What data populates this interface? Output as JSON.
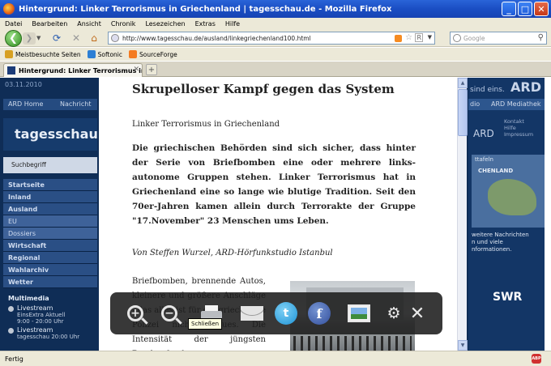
{
  "window": {
    "title": "Hintergrund: Linker Terrorismus in Griechenland | tagesschau.de - Mozilla Firefox",
    "minimize": "_",
    "maximize": "□",
    "close": "✕"
  },
  "menu": [
    "Datei",
    "Bearbeiten",
    "Ansicht",
    "Chronik",
    "Lesezeichen",
    "Extras",
    "Hilfe"
  ],
  "navbar": {
    "url": "http://www.tagesschau.de/ausland/linkegriechenland100.html",
    "search_placeholder": "Google"
  },
  "bookmarks": [
    {
      "label": "Meistbesuchte Seiten",
      "color": "#d7a021"
    },
    {
      "label": "Softonic",
      "color": "#2d7fd4"
    },
    {
      "label": "SourceForge",
      "color": "#f47b20"
    }
  ],
  "tab": {
    "title": "Hintergrund: Linker Terrorismus in G..."
  },
  "background": {
    "date": "03.11.2010",
    "nav": [
      "ARD Home",
      "Nachricht"
    ],
    "logo": "tagesschau",
    "search_label": "Suchbegriff",
    "menu": [
      "Startseite",
      "Inland",
      "Ausland",
      "EU",
      "Dossiers",
      "Wirtschaft",
      "Regional",
      "Wahlarchiv",
      "Wetter"
    ],
    "multimedia": "Multimedia",
    "live1": {
      "title": "Livestream",
      "sub": "EinsExtra Aktuell",
      "time": "9:00 - 20:00 Uhr"
    },
    "live2": {
      "title": "Livestream",
      "sub": "tagesschau 20:00 Uhr"
    },
    "right_brand": "ARD",
    "right_sind": "sind eins.",
    "right_bar": [
      "dio",
      "ARD Mediathek"
    ],
    "right_ard2": "ARD",
    "kontakt": [
      "Kontakt",
      "Hilfe",
      "Impressum"
    ],
    "map_label": "CHENLAND",
    "map_title": "ttafeln",
    "right_text": "weitere Nachrichten\nn und viele\nnformationen.",
    "swr": "SWR"
  },
  "article": {
    "headline": "Skrupelloser Kampf gegen das System",
    "kicker": "Linker Terrorismus in Griechenland",
    "lead": "Die griechischen Behörden sind sich sicher, dass hinter der Serie von Briefbomben eine oder mehrere links-autonome Gruppen stehen. Linker Terrorismus hat in Griechenland eine so lange wie blutige Tradition. Seit den 70er-Jahren kamen allein durch Terrorakte der Gruppe \"17.November\" 23 Menschen ums Leben.",
    "author": "Von Steffen Wurzel, ARD-Hörfunkstudio Istanbul",
    "body": "Briefbomben, brennende Autos, kleinere und größere Anschläge - das alles ist für die griechische Polizei nichts Neues. Die Intensität der jüngsten Bombenfunde"
  },
  "toolbar": {
    "tooltip": "Schließen",
    "icons": [
      "zoom-in",
      "zoom-out",
      "print",
      "mail",
      "twitter",
      "facebook",
      "picture",
      "settings",
      "close"
    ]
  },
  "statusbar": {
    "text": "Fertig",
    "addon": "ABP"
  }
}
